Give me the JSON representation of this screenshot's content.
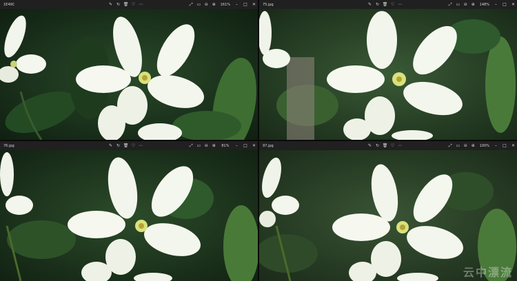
{
  "windows": [
    {
      "file_name": "1E49C",
      "zoom": "161%"
    },
    {
      "file_name": "75.jpg",
      "zoom": "148%"
    },
    {
      "file_name": "76.jpg",
      "zoom": "81%"
    },
    {
      "file_name": "97.jpg",
      "zoom": "100%"
    }
  ],
  "toolbar_icons": [
    "edit-icon",
    "rotate-icon",
    "delete-icon",
    "favorite-icon",
    "more-icon"
  ],
  "view_icons": [
    "fullscreen-icon",
    "fit-icon",
    "zoom-out-icon",
    "zoom-in-icon"
  ],
  "window_controls": [
    "minimize-icon",
    "maximize-icon",
    "close-icon"
  ],
  "watermark": "云中漂流",
  "colors": {
    "bar": "#202020",
    "bar_text": "#d8d8d8",
    "leaf_dark": "#1f3a1f",
    "leaf_light": "#4c7a3a",
    "petal": "#f4f7ee"
  }
}
